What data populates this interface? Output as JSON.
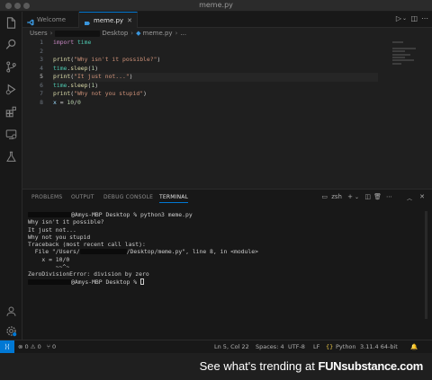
{
  "window": {
    "title": "meme.py"
  },
  "tabs": [
    {
      "label": "Welcome"
    },
    {
      "label": "meme.py"
    }
  ],
  "breadcrumb": {
    "root": "Users",
    "folder": "Desktop",
    "file": "meme.py",
    "trail": "..."
  },
  "editor": {
    "line_numbers": [
      "1",
      "2",
      "3",
      "4",
      "5",
      "6",
      "7",
      "8"
    ],
    "current_line": 5,
    "lines": [
      [
        {
          "t": "kw",
          "v": "import"
        },
        {
          "t": "p",
          "v": " "
        },
        {
          "t": "mod",
          "v": "time"
        }
      ],
      [],
      [
        {
          "t": "fn",
          "v": "print"
        },
        {
          "t": "p",
          "v": "("
        },
        {
          "t": "str",
          "v": "\"Why isn't it possible?\""
        },
        {
          "t": "p",
          "v": ")"
        }
      ],
      [
        {
          "t": "mod",
          "v": "time"
        },
        {
          "t": "p",
          "v": "."
        },
        {
          "t": "fn",
          "v": "sleep"
        },
        {
          "t": "p",
          "v": "("
        },
        {
          "t": "num",
          "v": "1"
        },
        {
          "t": "p",
          "v": ")"
        }
      ],
      [
        {
          "t": "fn",
          "v": "print"
        },
        {
          "t": "p",
          "v": "("
        },
        {
          "t": "str",
          "v": "\"It just not...\""
        },
        {
          "t": "p",
          "v": ")"
        }
      ],
      [
        {
          "t": "mod",
          "v": "time"
        },
        {
          "t": "p",
          "v": "."
        },
        {
          "t": "fn",
          "v": "sleep"
        },
        {
          "t": "p",
          "v": "("
        },
        {
          "t": "num",
          "v": "1"
        },
        {
          "t": "p",
          "v": ")"
        }
      ],
      [
        {
          "t": "fn",
          "v": "print"
        },
        {
          "t": "p",
          "v": "("
        },
        {
          "t": "str",
          "v": "\"Why not you stupid\""
        },
        {
          "t": "p",
          "v": ")"
        }
      ],
      [
        {
          "t": "var",
          "v": "x"
        },
        {
          "t": "p",
          "v": " = "
        },
        {
          "t": "num",
          "v": "10"
        },
        {
          "t": "p",
          "v": "/"
        },
        {
          "t": "num",
          "v": "0"
        }
      ]
    ]
  },
  "panel": {
    "tabs": [
      "PROBLEMS",
      "OUTPUT",
      "DEBUG CONSOLE",
      "TERMINAL"
    ],
    "active_tab": "TERMINAL",
    "shell_label": "zsh"
  },
  "terminal": {
    "prompt_suffix": "@Amys-MBP Desktop %",
    "command": " python3 meme.py",
    "output": [
      "Why isn't it possible?",
      "It just not...",
      "Why not you stupid",
      "Traceback (most recent call last):"
    ],
    "file_line_prefix": "  File \"/Users/",
    "file_line_suffix": "/Desktop/meme.py\", line 8, in <module>",
    "code_line": "    x = 10/0",
    "caret_line": "        ~~^~",
    "error_line": "ZeroDivisionError: division by zero",
    "final_prompt": "@Amys-MBP Desktop % "
  },
  "statusbar": {
    "problems": "⊗ 0 ⚠ 0",
    "ports": "⑂ 0",
    "position": "Ln 5, Col 22",
    "spaces": "Spaces: 4",
    "encoding": "UTF-8",
    "eol": "LF",
    "language": "Python",
    "interpreter": "3.11.4 64-bit"
  },
  "watermark": {
    "text": "See what's trending at",
    "brand": "FUNsubstance.com"
  },
  "colors": {
    "accent": "#0078d4",
    "keyword": "#c586c0",
    "function": "#dcdcaa",
    "string": "#ce9178",
    "module": "#4ec9b0",
    "number": "#b5cea8"
  },
  "icons": [
    "explorer-icon",
    "search-icon",
    "source-control-icon",
    "run-debug-icon",
    "extensions-icon",
    "remote-explorer-icon",
    "testing-icon",
    "account-icon",
    "settings-gear-icon"
  ]
}
